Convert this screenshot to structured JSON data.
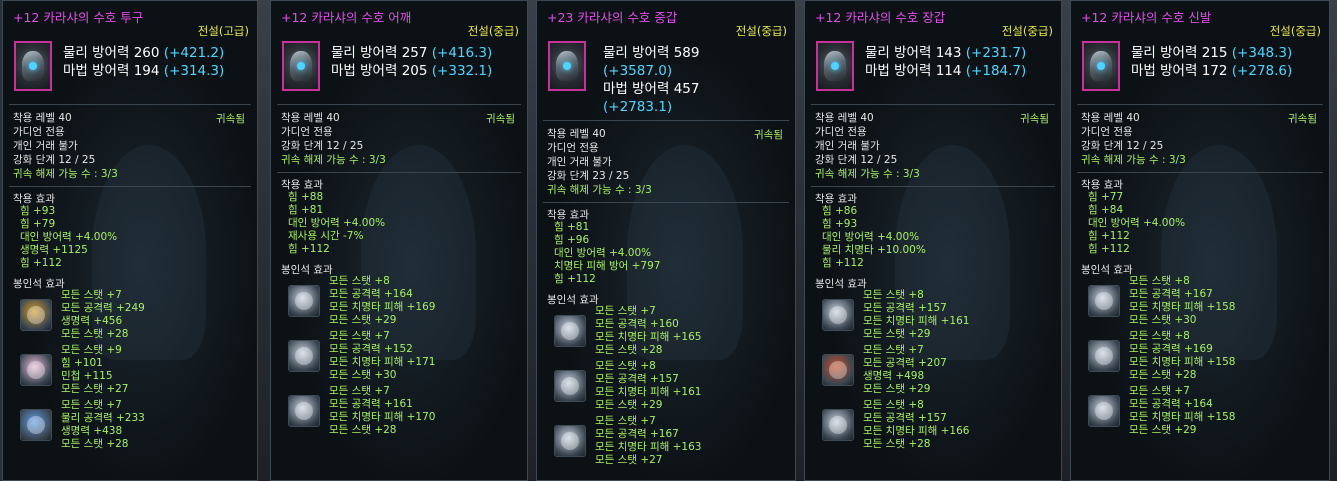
{
  "labels": {
    "phys_def": "물리 방어력",
    "mag_def": "마법 방어력",
    "req_level": "착용 레벨",
    "class": "가디언 전용",
    "untradable": "개인 거래 불가",
    "enhance": "강화 단계",
    "unbind": "귀속 해제 가능 수 :",
    "bound": "귀속됨",
    "equip_effects": "착용 효과",
    "stone_effects": "봉인석 효과"
  },
  "items": [
    {
      "title": "+12 카라샤의 수호 투구",
      "grade": "전설(고급)",
      "icon": "helmet-icon",
      "phys": "260",
      "phys_bonus": "(+421.2)",
      "mag": "194",
      "mag_bonus": "(+314.3)",
      "level": "40",
      "enhance": "12 / 25",
      "unbind": "3/3",
      "effects": [
        "힘 +93",
        "힘 +79",
        "대인 방어력 +4.00%",
        "생명력 +1125",
        "힘 +112"
      ],
      "stones": [
        {
          "icon": "dragon-stone-icon",
          "color": "#d49a2a",
          "lines": [
            "모든 스탯 +7",
            "모든 공격력 +249",
            "생명력 +456",
            "모든 스탯 +28"
          ]
        },
        {
          "icon": "priestess-stone-icon",
          "color": "#e8b8d8",
          "lines": [
            "모든 스탯 +9",
            "힘 +101",
            "민첩 +115",
            "모든 스탯 +27"
          ]
        },
        {
          "icon": "frost-beast-stone-icon",
          "color": "#5d9be8",
          "lines": [
            "모든 스탯 +7",
            "물리 공격력 +233",
            "생명력 +438",
            "모든 스탯 +28"
          ]
        }
      ]
    },
    {
      "title": "+12 카라샤의 수호 어깨",
      "grade": "전설(중급)",
      "icon": "pauldron-icon",
      "phys": "257",
      "phys_bonus": "(+416.3)",
      "mag": "205",
      "mag_bonus": "(+332.1)",
      "level": "40",
      "enhance": "12 / 25",
      "unbind": "3/3",
      "effects": [
        "힘 +88",
        "힘 +81",
        "대인 방어력 +4.00%",
        "재사용 시간 -7%",
        "힘 +112"
      ],
      "stones": [
        {
          "icon": "griffin-stone-icon",
          "color": "#c9d3e0",
          "lines": [
            "모든 스탯 +8",
            "모든 공격력 +164",
            "모든 치명타 피해 +169",
            "모든 스탯 +29"
          ]
        },
        {
          "icon": "griffin-stone-icon",
          "color": "#c9d3e0",
          "lines": [
            "모든 스탯 +7",
            "모든 공격력 +152",
            "모든 치명타 피해 +171",
            "모든 스탯 +30"
          ]
        },
        {
          "icon": "griffin-stone-icon",
          "color": "#c9d3e0",
          "lines": [
            "모든 스탯 +7",
            "모든 공격력 +161",
            "모든 치명타 피해 +170",
            "모든 스탯 +28"
          ]
        }
      ]
    },
    {
      "title": "+23 카라샤의 수호 중갑",
      "grade": "전설(중급)",
      "icon": "armor-icon",
      "phys": "589",
      "phys_bonus": "(+3587.0)",
      "mag": "457",
      "mag_bonus": "(+2783.1)",
      "level": "40",
      "enhance": "23 / 25",
      "unbind": "3/3",
      "effects": [
        "힘 +81",
        "힘 +96",
        "대인 방어력 +4.00%",
        "치명타 피해 방어 +797",
        "힘 +112"
      ],
      "stones": [
        {
          "icon": "griffin-stone-icon",
          "color": "#c9d3e0",
          "lines": [
            "모든 스탯 +7",
            "모든 공격력 +160",
            "모든 치명타 피해 +165",
            "모든 스탯 +28"
          ]
        },
        {
          "icon": "griffin-stone-icon",
          "color": "#c9d3e0",
          "lines": [
            "모든 스탯 +8",
            "모든 공격력 +157",
            "모든 치명타 피해 +161",
            "모든 스탯 +29"
          ]
        },
        {
          "icon": "griffin-stone-icon",
          "color": "#c9d3e0",
          "lines": [
            "모든 스탯 +7",
            "모든 공격력 +167",
            "모든 치명타 피해 +163",
            "모든 스탯 +27"
          ]
        }
      ]
    },
    {
      "title": "+12 카라샤의 수호 장갑",
      "grade": "전설(중급)",
      "icon": "gauntlet-icon",
      "phys": "143",
      "phys_bonus": "(+231.7)",
      "mag": "114",
      "mag_bonus": "(+184.7)",
      "level": "40",
      "enhance": "12 / 25",
      "unbind": "3/3",
      "effects": [
        "힘 +86",
        "힘 +93",
        "대인 방어력 +4.00%",
        "물리 치명타 +10.00%",
        "힘 +112"
      ],
      "stones": [
        {
          "icon": "griffin-stone-icon",
          "color": "#c9d3e0",
          "lines": [
            "모든 스탯 +8",
            "모든 공격력 +157",
            "모든 치명타 피해 +161",
            "모든 스탯 +29"
          ]
        },
        {
          "icon": "fire-beast-stone-icon",
          "color": "#c8502a",
          "lines": [
            "모든 스탯 +7",
            "모든 공격력 +207",
            "생명력 +498",
            "모든 스탯 +29"
          ]
        },
        {
          "icon": "griffin-stone-icon",
          "color": "#c9d3e0",
          "lines": [
            "모든 스탯 +8",
            "모든 공격력 +157",
            "모든 치명타 피해 +166",
            "모든 스탯 +28"
          ]
        }
      ]
    },
    {
      "title": "+12 카라샤의 수호 신발",
      "grade": "전설(중급)",
      "icon": "boots-icon",
      "phys": "215",
      "phys_bonus": "(+348.3)",
      "mag": "172",
      "mag_bonus": "(+278.6)",
      "level": "40",
      "enhance": "12 / 25",
      "unbind": "3/3",
      "effects": [
        "힘 +77",
        "힘 +84",
        "대인 방어력 +4.00%",
        "힘 +112",
        "힘 +112"
      ],
      "stones": [
        {
          "icon": "griffin-stone-icon",
          "color": "#c9d3e0",
          "lines": [
            "모든 스탯 +8",
            "모든 공격력 +167",
            "모든 치명타 피해 +158",
            "모든 스탯 +30"
          ]
        },
        {
          "icon": "griffin-stone-icon",
          "color": "#c9d3e0",
          "lines": [
            "모든 스탯 +8",
            "모든 공격력 +169",
            "모든 치명타 피해 +158",
            "모든 스탯 +28"
          ]
        },
        {
          "icon": "griffin-stone-icon",
          "color": "#c9d3e0",
          "lines": [
            "모든 스탯 +7",
            "모든 공격력 +164",
            "모든 치명타 피해 +158",
            "모든 스탯 +29"
          ]
        }
      ]
    }
  ]
}
